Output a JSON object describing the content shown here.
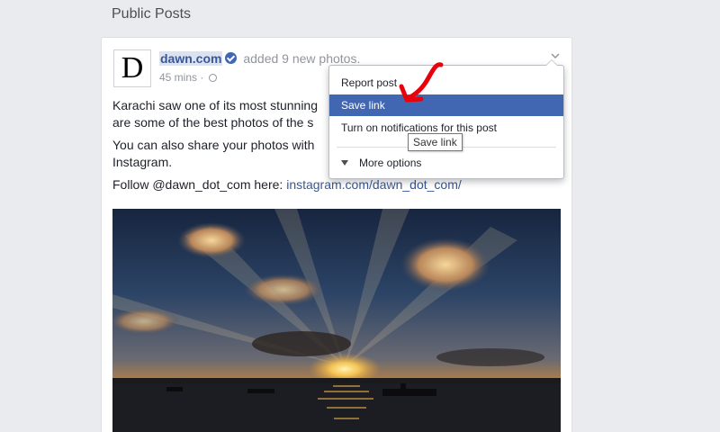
{
  "section": {
    "title": "Public Posts"
  },
  "post": {
    "avatar_letter": "D",
    "page_name": "dawn.com",
    "action": "added 9 new photos.",
    "time": "45 mins · ",
    "paragraphs": [
      "Karachi saw one of its most stunning",
      "are some of the best photos of the s",
      "You can also share your photos with",
      "Instagram."
    ],
    "follow_text": "Follow @dawn_dot_com here: ",
    "follow_link": "instagram.com/dawn_dot_com/",
    "photo_alt": "Sunset over the sea in Karachi"
  },
  "menu": {
    "items": [
      "Report post",
      "Save link",
      "Turn on notifications for this post"
    ],
    "more": "More options"
  },
  "tooltip": "Save link",
  "colors": {
    "background": "#e9ebee",
    "link": "#365899",
    "menu_highlight": "#4267b2",
    "annotation": "#e8000b"
  }
}
